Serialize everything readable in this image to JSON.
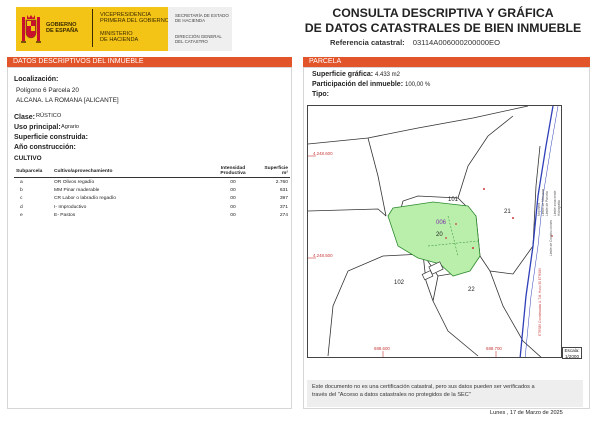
{
  "header": {
    "gov_name": [
      "GOBIERNO",
      "DE ESPAÑA"
    ],
    "vice_title": [
      "VICEPRESIDENCIA",
      "PRIMERA DEL GOBIERNO"
    ],
    "ministry": [
      "MINISTERIO",
      "DE HACIENDA"
    ],
    "secretaria": [
      "SECRETARÍA DE ESTADO",
      "DE HACIENDA"
    ],
    "direccion": [
      "DIRECCIÓN GENERAL",
      "DEL CATASTRO"
    ],
    "title_line1": "CONSULTA DESCRIPTIVA Y GRÁFICA",
    "title_line2": "DE DATOS CATASTRALES DE BIEN INMUEBLE",
    "ref_label": "Referencia catastral:",
    "ref_value": "03114A006000200000EO"
  },
  "left": {
    "bar_title": "DATOS DESCRIPTIVOS DEL INMUEBLE",
    "localizacion_label": "Localización:",
    "localizacion_line1": "Polígono 6 Parcela 20",
    "localizacion_line2": "ALCANA. LA ROMANA [ALICANTE]",
    "clase_label": "Clase:",
    "clase_value": "RÚSTICO",
    "uso_label": "Uso principal:",
    "uso_value": "Agrario",
    "superficie_label": "Superficie construida:",
    "anio_label": "Año construcción:",
    "cultivo_label": "CULTIVO",
    "table_headers": [
      "Subparcela",
      "Cultivo/aprovechamiento",
      "Intensidad Productiva",
      "Superficie m²"
    ],
    "table_rows": [
      [
        "a",
        "OR Olivos regadío",
        "00",
        "2.760"
      ],
      [
        "b",
        "MM Pinar maderable",
        "00",
        "631"
      ],
      [
        "c",
        "CR Labor o labradío regadío",
        "00",
        "397"
      ],
      [
        "d",
        "I- Improductivo",
        "00",
        "371"
      ],
      [
        "e",
        "E- Pastos",
        "00",
        "274"
      ]
    ]
  },
  "right": {
    "bar_title": "PARCELA",
    "sup_grafica_label": "Superficie gráfica:",
    "sup_grafica_value": "4.433 m2",
    "participacion_label": "Participación del inmueble:",
    "participacion_value": "100,00 %",
    "tipo_label": "Tipo:"
  },
  "map": {
    "parcel_labels": [
      "101",
      "21",
      "20",
      "006",
      "102",
      "22"
    ],
    "y_labels": [
      "4.248.600",
      "4.248.500"
    ],
    "x_labels": [
      "688.600",
      "688.700"
    ],
    "legend": [
      "Mojonera",
      "Límite de Manzana",
      "Límite de Parcela",
      "Límite de Construcciones",
      "Límite zona verde",
      "Hidrografía"
    ],
    "side_note": "ETRS89 Coordenadas U.T.M. Huso 30 ETRS89",
    "scale_label": "Escala:",
    "scale_value": "1/2000"
  },
  "footer": {
    "notice_line1": "Este documento no es una certificación catastral, pero sus datos pueden ser verificados a",
    "notice_line2": "través del \"Acceso a datos catastrales no protegidos de la SEC\"",
    "date": "Lunes , 17 de Marzo de 2025"
  }
}
